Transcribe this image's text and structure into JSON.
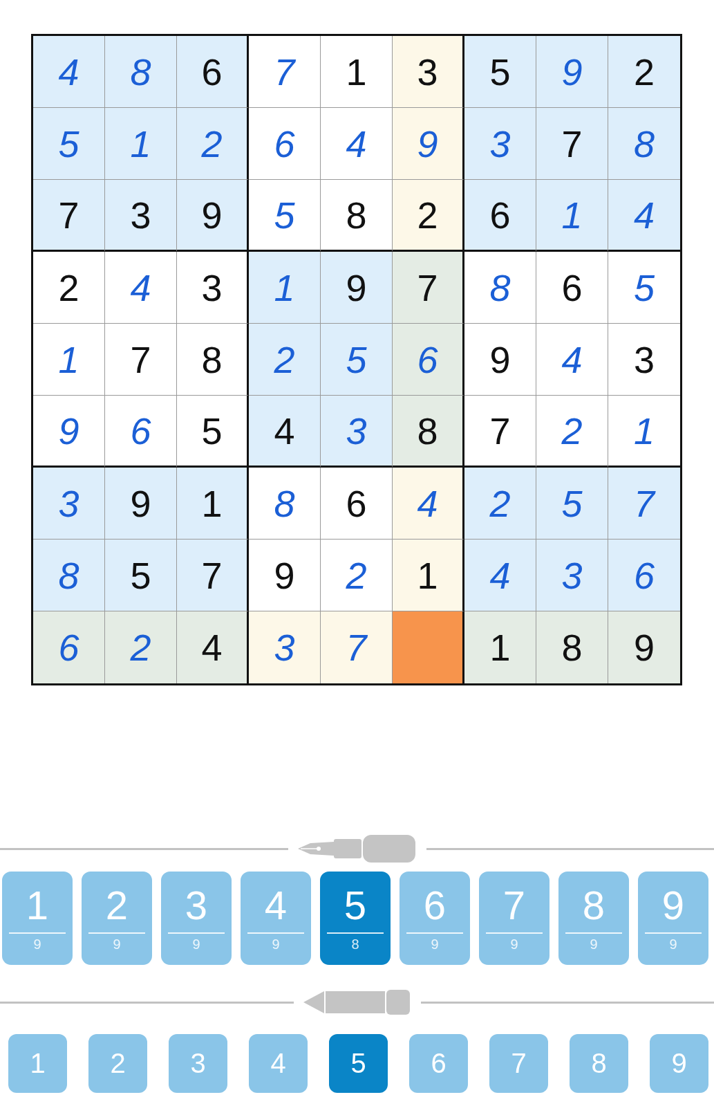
{
  "grid": {
    "rows": [
      {
        "cells": [
          {
            "value": "4",
            "entered": true,
            "selected": false,
            "color": "#ddeefb"
          },
          {
            "value": "8",
            "entered": true,
            "selected": false,
            "color": "#ddeefb"
          },
          {
            "value": "6",
            "entered": false,
            "selected": false,
            "color": "#ddeefb"
          },
          {
            "value": "7",
            "entered": true,
            "selected": false,
            "color": "#ffffff"
          },
          {
            "value": "1",
            "entered": false,
            "selected": false,
            "color": "#ffffff"
          },
          {
            "value": "3",
            "entered": false,
            "selected": false,
            "color": "#fdf8e8"
          },
          {
            "value": "5",
            "entered": false,
            "selected": false,
            "color": "#ddeefb"
          },
          {
            "value": "9",
            "entered": true,
            "selected": false,
            "color": "#ddeefb"
          },
          {
            "value": "2",
            "entered": false,
            "selected": false,
            "color": "#ddeefb"
          }
        ]
      },
      {
        "cells": [
          {
            "value": "5",
            "entered": true,
            "selected": false,
            "color": "#ddeefb"
          },
          {
            "value": "1",
            "entered": true,
            "selected": false,
            "color": "#ddeefb"
          },
          {
            "value": "2",
            "entered": true,
            "selected": false,
            "color": "#ddeefb"
          },
          {
            "value": "6",
            "entered": true,
            "selected": false,
            "color": "#ffffff"
          },
          {
            "value": "4",
            "entered": true,
            "selected": false,
            "color": "#ffffff"
          },
          {
            "value": "9",
            "entered": true,
            "selected": false,
            "color": "#fdf8e8"
          },
          {
            "value": "3",
            "entered": true,
            "selected": false,
            "color": "#ddeefb"
          },
          {
            "value": "7",
            "entered": false,
            "selected": false,
            "color": "#ddeefb"
          },
          {
            "value": "8",
            "entered": true,
            "selected": false,
            "color": "#ddeefb"
          }
        ]
      },
      {
        "cells": [
          {
            "value": "7",
            "entered": false,
            "selected": false,
            "color": "#ddeefb"
          },
          {
            "value": "3",
            "entered": false,
            "selected": false,
            "color": "#ddeefb"
          },
          {
            "value": "9",
            "entered": false,
            "selected": false,
            "color": "#ddeefb"
          },
          {
            "value": "5",
            "entered": true,
            "selected": false,
            "color": "#ffffff"
          },
          {
            "value": "8",
            "entered": false,
            "selected": false,
            "color": "#ffffff"
          },
          {
            "value": "2",
            "entered": false,
            "selected": false,
            "color": "#fdf8e8"
          },
          {
            "value": "6",
            "entered": false,
            "selected": false,
            "color": "#ddeefb"
          },
          {
            "value": "1",
            "entered": true,
            "selected": false,
            "color": "#ddeefb"
          },
          {
            "value": "4",
            "entered": true,
            "selected": false,
            "color": "#ddeefb"
          }
        ]
      },
      {
        "cells": [
          {
            "value": "2",
            "entered": false,
            "selected": false,
            "color": "#ffffff"
          },
          {
            "value": "4",
            "entered": true,
            "selected": false,
            "color": "#ffffff"
          },
          {
            "value": "3",
            "entered": false,
            "selected": false,
            "color": "#ffffff"
          },
          {
            "value": "1",
            "entered": true,
            "selected": false,
            "color": "#ddeefb"
          },
          {
            "value": "9",
            "entered": false,
            "selected": false,
            "color": "#ddeefb"
          },
          {
            "value": "7",
            "entered": false,
            "selected": false,
            "color": "#e4ece4"
          },
          {
            "value": "8",
            "entered": true,
            "selected": false,
            "color": "#ffffff"
          },
          {
            "value": "6",
            "entered": false,
            "selected": false,
            "color": "#ffffff"
          },
          {
            "value": "5",
            "entered": true,
            "selected": false,
            "color": "#ffffff"
          }
        ]
      },
      {
        "cells": [
          {
            "value": "1",
            "entered": true,
            "selected": false,
            "color": "#ffffff"
          },
          {
            "value": "7",
            "entered": false,
            "selected": false,
            "color": "#ffffff"
          },
          {
            "value": "8",
            "entered": false,
            "selected": false,
            "color": "#ffffff"
          },
          {
            "value": "2",
            "entered": true,
            "selected": false,
            "color": "#ddeefb"
          },
          {
            "value": "5",
            "entered": true,
            "selected": false,
            "color": "#ddeefb"
          },
          {
            "value": "6",
            "entered": true,
            "selected": false,
            "color": "#e4ece4"
          },
          {
            "value": "9",
            "entered": false,
            "selected": false,
            "color": "#ffffff"
          },
          {
            "value": "4",
            "entered": true,
            "selected": false,
            "color": "#ffffff"
          },
          {
            "value": "3",
            "entered": false,
            "selected": false,
            "color": "#ffffff"
          }
        ]
      },
      {
        "cells": [
          {
            "value": "9",
            "entered": true,
            "selected": false,
            "color": "#ffffff"
          },
          {
            "value": "6",
            "entered": true,
            "selected": false,
            "color": "#ffffff"
          },
          {
            "value": "5",
            "entered": false,
            "selected": false,
            "color": "#ffffff"
          },
          {
            "value": "4",
            "entered": false,
            "selected": false,
            "color": "#ddeefb"
          },
          {
            "value": "3",
            "entered": true,
            "selected": false,
            "color": "#ddeefb"
          },
          {
            "value": "8",
            "entered": false,
            "selected": false,
            "color": "#e4ece4"
          },
          {
            "value": "7",
            "entered": false,
            "selected": false,
            "color": "#ffffff"
          },
          {
            "value": "2",
            "entered": true,
            "selected": false,
            "color": "#ffffff"
          },
          {
            "value": "1",
            "entered": true,
            "selected": false,
            "color": "#ffffff"
          }
        ]
      },
      {
        "cells": [
          {
            "value": "3",
            "entered": true,
            "selected": false,
            "color": "#ddeefb"
          },
          {
            "value": "9",
            "entered": false,
            "selected": false,
            "color": "#ddeefb"
          },
          {
            "value": "1",
            "entered": false,
            "selected": false,
            "color": "#ddeefb"
          },
          {
            "value": "8",
            "entered": true,
            "selected": false,
            "color": "#ffffff"
          },
          {
            "value": "6",
            "entered": false,
            "selected": false,
            "color": "#ffffff"
          },
          {
            "value": "4",
            "entered": true,
            "selected": false,
            "color": "#fdf8e8"
          },
          {
            "value": "2",
            "entered": true,
            "selected": false,
            "color": "#ddeefb"
          },
          {
            "value": "5",
            "entered": true,
            "selected": false,
            "color": "#ddeefb"
          },
          {
            "value": "7",
            "entered": true,
            "selected": false,
            "color": "#ddeefb"
          }
        ]
      },
      {
        "cells": [
          {
            "value": "8",
            "entered": true,
            "selected": false,
            "color": "#ddeefb"
          },
          {
            "value": "5",
            "entered": false,
            "selected": false,
            "color": "#ddeefb"
          },
          {
            "value": "7",
            "entered": false,
            "selected": false,
            "color": "#ddeefb"
          },
          {
            "value": "9",
            "entered": false,
            "selected": false,
            "color": "#ffffff"
          },
          {
            "value": "2",
            "entered": true,
            "selected": false,
            "color": "#ffffff"
          },
          {
            "value": "1",
            "entered": false,
            "selected": false,
            "color": "#fdf8e8"
          },
          {
            "value": "4",
            "entered": true,
            "selected": false,
            "color": "#ddeefb"
          },
          {
            "value": "3",
            "entered": true,
            "selected": false,
            "color": "#ddeefb"
          },
          {
            "value": "6",
            "entered": true,
            "selected": false,
            "color": "#ddeefb"
          }
        ]
      },
      {
        "cells": [
          {
            "value": "6",
            "entered": true,
            "selected": false,
            "color": "#e4ece4"
          },
          {
            "value": "2",
            "entered": true,
            "selected": false,
            "color": "#e4ece4"
          },
          {
            "value": "4",
            "entered": false,
            "selected": false,
            "color": "#e4ece4"
          },
          {
            "value": "3",
            "entered": true,
            "selected": false,
            "color": "#fdf8e8"
          },
          {
            "value": "7",
            "entered": true,
            "selected": false,
            "color": "#fdf8e8"
          },
          {
            "selected": true
          },
          {
            "value": "1",
            "entered": false,
            "selected": false,
            "color": "#e4ece4"
          },
          {
            "value": "8",
            "entered": false,
            "selected": false,
            "color": "#e4ece4"
          },
          {
            "value": "9",
            "entered": false,
            "selected": false,
            "color": "#e4ece4"
          }
        ]
      }
    ]
  },
  "pen_pad": [
    {
      "digit": "1",
      "count": "9",
      "selected": false
    },
    {
      "digit": "2",
      "count": "9",
      "selected": false
    },
    {
      "digit": "3",
      "count": "9",
      "selected": false
    },
    {
      "digit": "4",
      "count": "9",
      "selected": false
    },
    {
      "digit": "5",
      "count": "8",
      "selected": true
    },
    {
      "digit": "6",
      "count": "9",
      "selected": false
    },
    {
      "digit": "7",
      "count": "9",
      "selected": false
    },
    {
      "digit": "8",
      "count": "9",
      "selected": false
    },
    {
      "digit": "9",
      "count": "9",
      "selected": false
    }
  ],
  "pencil_pad": [
    {
      "digit": "1",
      "selected": false
    },
    {
      "digit": "2",
      "selected": false
    },
    {
      "digit": "3",
      "selected": false
    },
    {
      "digit": "4",
      "selected": false
    },
    {
      "digit": "5",
      "selected": true
    },
    {
      "digit": "6",
      "selected": false
    },
    {
      "digit": "7",
      "selected": false
    },
    {
      "digit": "8",
      "selected": false
    },
    {
      "digit": "9",
      "selected": false
    }
  ]
}
